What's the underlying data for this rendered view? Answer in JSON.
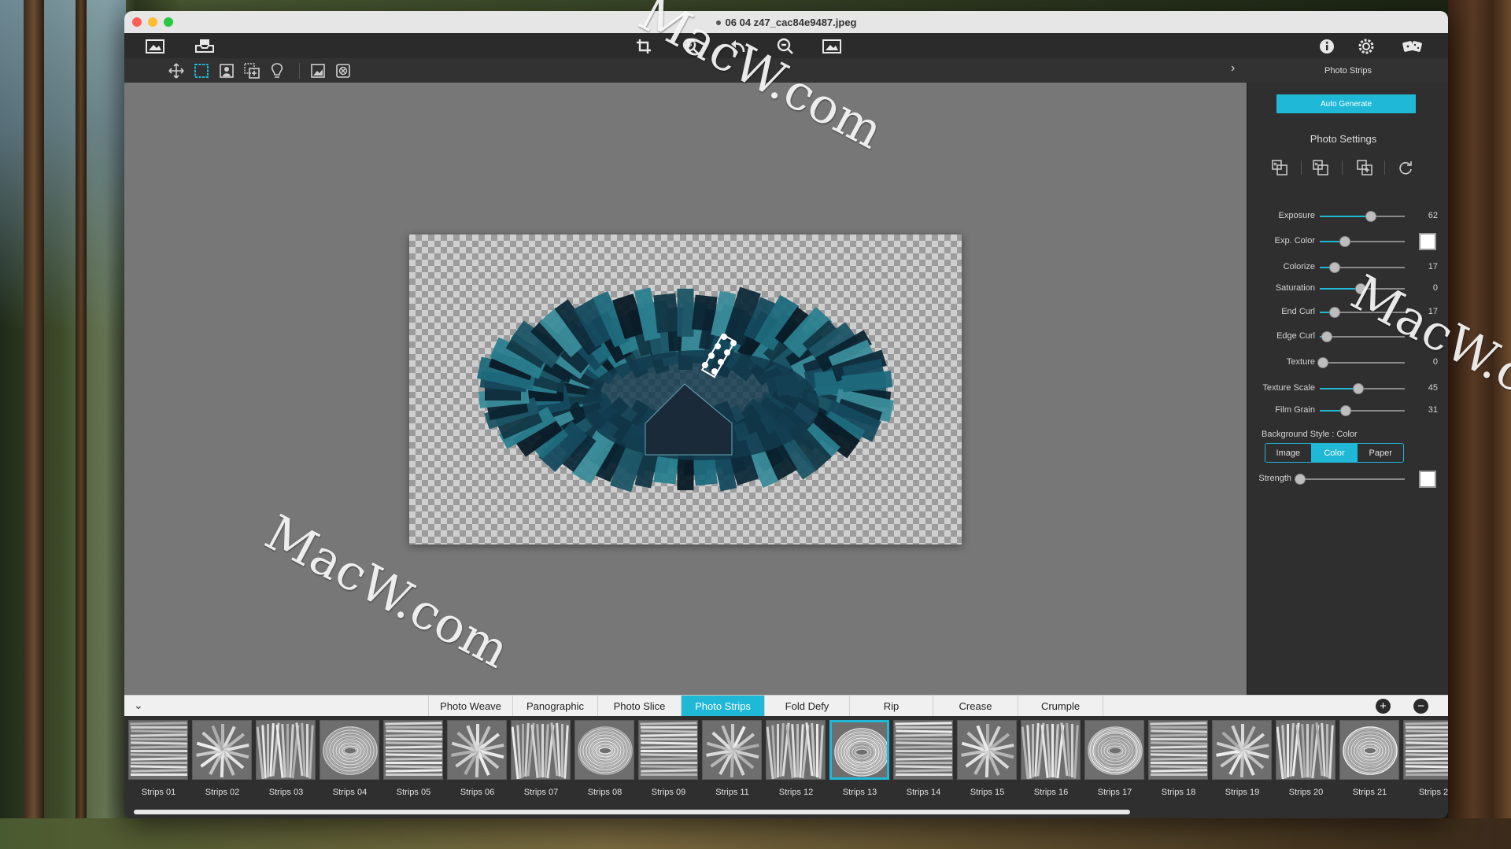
{
  "window": {
    "title": "06 04 z47_cac84e9487.jpeg"
  },
  "toolbar": {
    "left_icons": [
      "image-open-icon",
      "save-tray-icon"
    ],
    "center_icons": [
      "crop-icon",
      "zoom-in-icon",
      "undo-icon",
      "zoom-out-icon",
      "fit-image-icon"
    ],
    "right_icons": [
      "info-icon",
      "settings-icon",
      "dice-icon"
    ]
  },
  "tools": [
    "move-icon",
    "select-rect-icon",
    "portrait-icon",
    "add-region-icon",
    "bulb-icon",
    "image-adjust-icon",
    "clear-icon"
  ],
  "panel": {
    "heading": "Photo Strips",
    "auto_generate": "Auto Generate",
    "photo_settings": "Photo Settings",
    "setting_icons": [
      "copy-layer-icon",
      "swap-layer-icon",
      "add-layer-icon",
      "refresh-icon"
    ],
    "sliders": [
      {
        "label": "Exposure",
        "value": "62",
        "pos": 0.6
      },
      {
        "label": "Exp. Color",
        "value": "",
        "pos": 0.3,
        "swatch": "#ffffff"
      },
      {
        "label": "Colorize",
        "value": "17",
        "pos": 0.18
      },
      {
        "label": "Saturation",
        "value": "0",
        "pos": 0.48
      },
      {
        "label": "End Curl",
        "value": "17",
        "pos": 0.18
      },
      {
        "label": "Edge Curl",
        "value": "",
        "pos": 0.08
      },
      {
        "label": "Texture",
        "value": "0",
        "pos": 0.04
      },
      {
        "label": "Texture Scale",
        "value": "45",
        "pos": 0.45
      },
      {
        "label": "Film Grain",
        "value": "31",
        "pos": 0.31
      }
    ],
    "background_style_label": "Background Style : Color",
    "background_options": [
      "Image",
      "Color",
      "Paper"
    ],
    "background_selected": "Color",
    "strength": {
      "label": "Strength",
      "value": "",
      "pos": 0.05,
      "swatch": "#ffffff"
    }
  },
  "tabs": {
    "items": [
      "Photo Weave",
      "Panographic",
      "Photo Slice",
      "Photo Strips",
      "Fold Defy",
      "Rip",
      "Crease",
      "Crumple"
    ],
    "active": "Photo Strips",
    "add_label": "+",
    "remove_label": "−"
  },
  "thumbnails": {
    "items": [
      "Strips 01",
      "Strips 02",
      "Strips 03",
      "Strips 04",
      "Strips 05",
      "Strips 06",
      "Strips 07",
      "Strips 08",
      "Strips 09",
      "Strips 11",
      "Strips 12",
      "Strips 13",
      "Strips 14",
      "Strips 15",
      "Strips 16",
      "Strips 17",
      "Strips 18",
      "Strips 19",
      "Strips 20",
      "Strips 21",
      "Strips 2"
    ],
    "selected": "Strips 13"
  },
  "watermarks": [
    "MacW.com",
    "MacW.com",
    "MacW.com"
  ],
  "colors": {
    "accent": "#1fb8d6",
    "panel": "#2f2f2f",
    "canvas": "#777777"
  }
}
